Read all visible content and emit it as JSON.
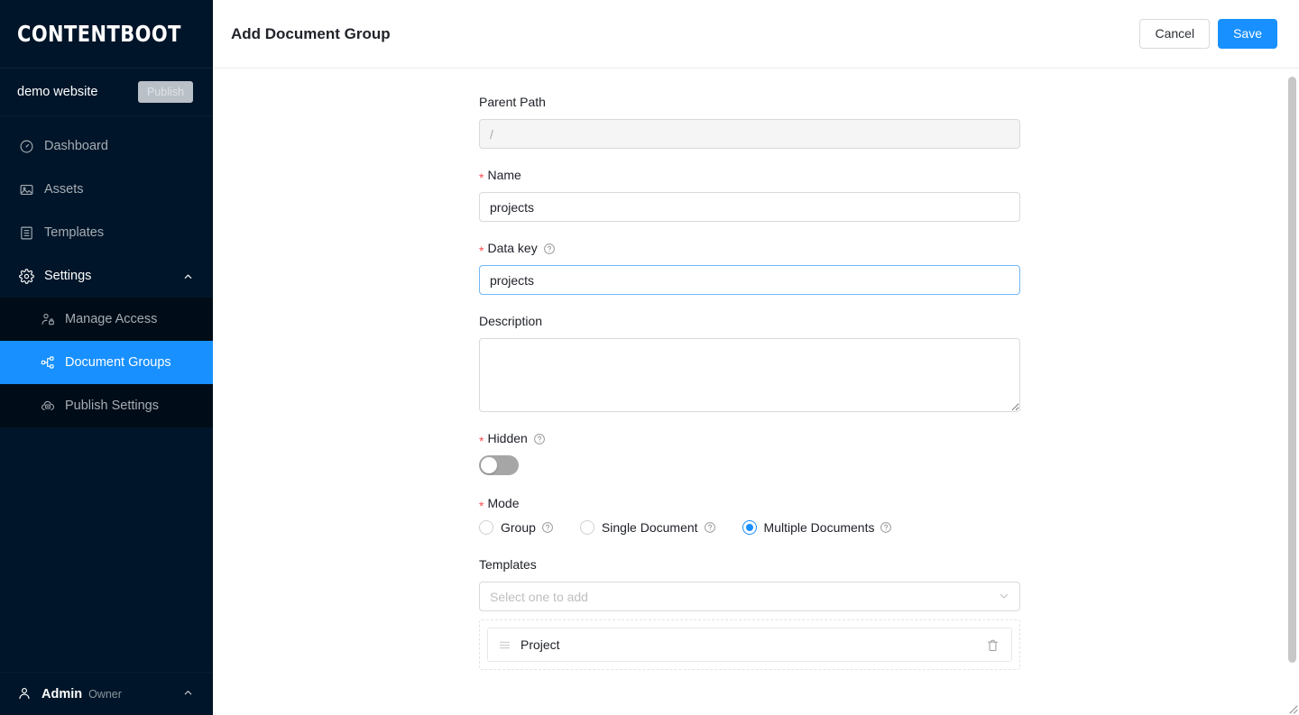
{
  "sidebar": {
    "logo": "CONTENTBOOT",
    "site": {
      "name": "demo website",
      "publish_label": "Publish"
    },
    "nav": [
      {
        "label": "Dashboard",
        "icon": "dashboard-icon"
      },
      {
        "label": "Assets",
        "icon": "assets-icon"
      },
      {
        "label": "Templates",
        "icon": "templates-icon"
      },
      {
        "label": "Settings",
        "icon": "gear-icon",
        "expanded": true
      }
    ],
    "submenu": [
      {
        "label": "Manage Access",
        "icon": "user-lock-icon",
        "active": false
      },
      {
        "label": "Document Groups",
        "icon": "sitemap-icon",
        "active": true
      },
      {
        "label": "Publish Settings",
        "icon": "cloud-upload-icon",
        "active": false
      }
    ],
    "user": {
      "name": "Admin",
      "role": "Owner"
    }
  },
  "header": {
    "title": "Add Document Group",
    "cancel_label": "Cancel",
    "save_label": "Save"
  },
  "form": {
    "parent_path": {
      "label": "Parent Path",
      "value": "/",
      "disabled": true
    },
    "name": {
      "label": "Name",
      "value": "projects",
      "required": true
    },
    "data_key": {
      "label": "Data key",
      "value": "projects",
      "required": true,
      "help": true,
      "focused": true
    },
    "description": {
      "label": "Description",
      "value": ""
    },
    "hidden": {
      "label": "Hidden",
      "required": true,
      "help": true,
      "state": "off"
    },
    "mode": {
      "label": "Mode",
      "required": true,
      "options": [
        {
          "label": "Group",
          "checked": false,
          "help": true
        },
        {
          "label": "Single Document",
          "checked": false,
          "help": true
        },
        {
          "label": "Multiple Documents",
          "checked": true,
          "help": true
        }
      ]
    },
    "templates": {
      "label": "Templates",
      "placeholder": "Select one to add",
      "items": [
        {
          "name": "Project"
        }
      ]
    }
  },
  "colors": {
    "sidebar_bg": "#001529",
    "submenu_bg": "#000c17",
    "accent": "#1890ff",
    "required_red": "#ff4d4f"
  }
}
